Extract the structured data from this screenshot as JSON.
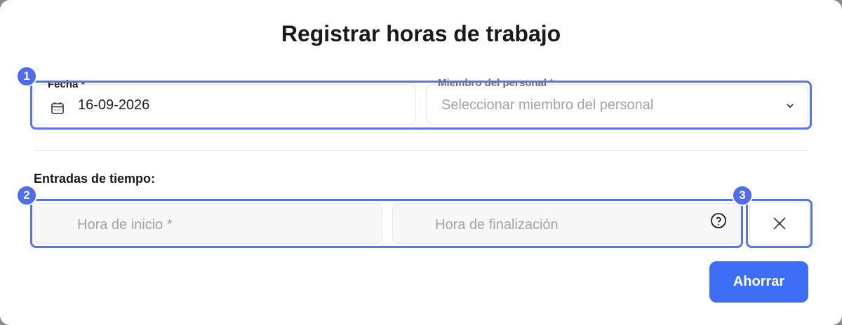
{
  "dialog": {
    "title": "Registrar horas de trabajo",
    "date_field": {
      "label": "Fecha *",
      "value": "16-09-2026",
      "icon": "calendar-icon"
    },
    "staff_field": {
      "label": "Miembro del personal *",
      "placeholder": "Seleccionar miembro del personal",
      "icon": "chevron-down-icon"
    },
    "time_entries": {
      "section_label": "Entradas de tiempo:",
      "start_placeholder": "Hora de inicio *",
      "end_placeholder": "Hora de finalización",
      "help_icon": "question-circle-icon",
      "remove_icon": "close-icon"
    },
    "save_label": "Ahorrar"
  },
  "annotations": [
    "1",
    "2",
    "3"
  ],
  "colors": {
    "accent": "#3d6ef5",
    "highlight": "#5874e8",
    "badge": "#4f6cea"
  }
}
